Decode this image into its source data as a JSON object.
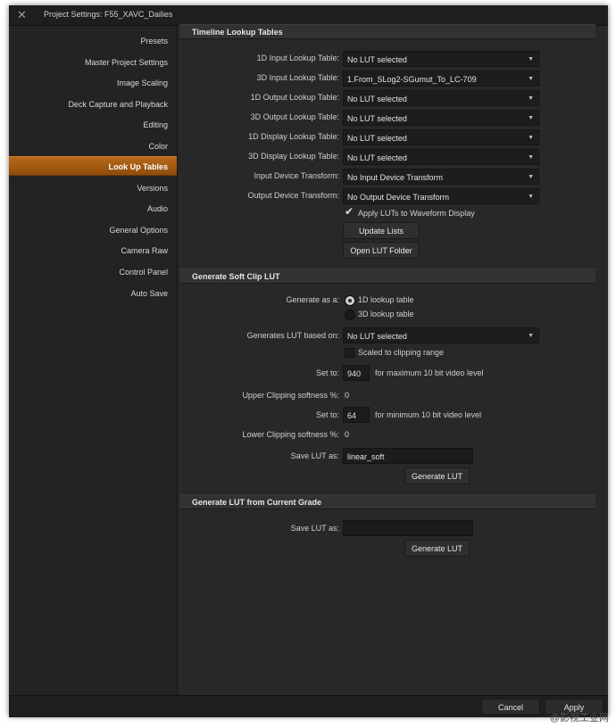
{
  "window": {
    "title": "Project Settings:  F55_XAVC_Dailies"
  },
  "sidebar": {
    "items": [
      {
        "label": "Presets"
      },
      {
        "label": "Master Project Settings"
      },
      {
        "label": "Image Scaling"
      },
      {
        "label": "Deck Capture and Playback"
      },
      {
        "label": "Editing"
      },
      {
        "label": "Color"
      },
      {
        "label": "Look Up Tables"
      },
      {
        "label": "Versions"
      },
      {
        "label": "Audio"
      },
      {
        "label": "General Options"
      },
      {
        "label": "Camera Raw"
      },
      {
        "label": "Control Panel"
      },
      {
        "label": "Auto Save"
      }
    ],
    "active_index": 6
  },
  "timeline_luts": {
    "header": "Timeline Lookup Tables",
    "rows": [
      {
        "label": "1D Input Lookup Table:",
        "value": "No LUT selected"
      },
      {
        "label": "3D Input Lookup Table:",
        "value": "1.From_SLog2-SGumut_To_LC-709"
      },
      {
        "label": "1D Output Lookup Table:",
        "value": "No LUT selected"
      },
      {
        "label": "3D Output Lookup Table:",
        "value": "No LUT selected"
      },
      {
        "label": "1D Display Lookup Table:",
        "value": "No LUT selected"
      },
      {
        "label": "3D Display Lookup Table:",
        "value": "No LUT selected"
      },
      {
        "label": "Input Device Transform:",
        "value": "No Input Device Transform"
      },
      {
        "label": "Output Device Transform:",
        "value": "No Output Device Transform"
      }
    ],
    "apply_waveform_label": "Apply LUTs to Waveform Display",
    "apply_waveform_checked": true,
    "update_lists_label": "Update Lists",
    "open_folder_label": "Open LUT Folder"
  },
  "soft_clip": {
    "header": "Generate Soft Clip LUT",
    "generate_as_label": "Generate as a:",
    "option_1d": "1D lookup table",
    "option_3d": "3D lookup table",
    "based_on_label": "Generates LUT based on:",
    "based_on_value": "No LUT selected",
    "scaled_label": "Scaled to clipping range",
    "set_to_label": "Set to:",
    "max_value": "940",
    "max_note": "for maximum 10 bit video level",
    "upper_soft_label": "Upper Clipping softness %:",
    "upper_soft_value": "0",
    "set_to_label_2": "Set to:",
    "min_value": "64",
    "min_note": "for minimum 10 bit video level",
    "lower_soft_label": "Lower Clipping softness %:",
    "lower_soft_value": "0",
    "save_as_label": "Save LUT as:",
    "save_as_value": "linear_soft",
    "generate_label": "Generate LUT"
  },
  "current_grade": {
    "header": "Generate LUT from Current Grade",
    "save_as_label": "Save LUT as:",
    "save_as_value": "",
    "generate_label": "Generate LUT"
  },
  "footer": {
    "cancel_label": "Cancel",
    "apply_label": "Apply"
  },
  "watermark": "@影视工业网",
  "colors": {
    "accent": "#a85e12",
    "background": "#282828",
    "sidebar": "#232323"
  }
}
